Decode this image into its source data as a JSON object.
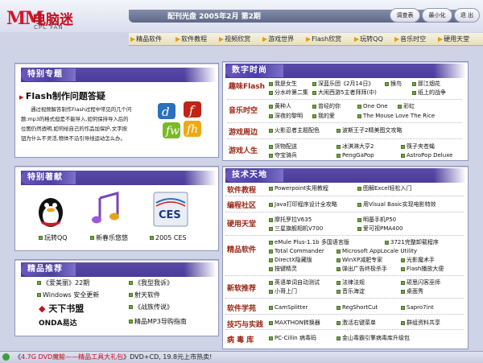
{
  "app": {
    "logo_mark": "MM",
    "logo_cn": "电脑迷",
    "logo_en": "CPC FAN",
    "issue": "配刊光盘   2005年2月 第2期"
  },
  "window_buttons": [
    {
      "label": "调查表"
    },
    {
      "label": "最小化"
    },
    {
      "label": "退 出"
    }
  ],
  "nav": [
    {
      "label": "精品软件"
    },
    {
      "label": "软件教程"
    },
    {
      "label": "视频欣赏"
    },
    {
      "label": "游戏世界"
    },
    {
      "label": "Flash欣赏"
    },
    {
      "label": "玩转QQ"
    },
    {
      "label": "音乐时空"
    },
    {
      "label": "硬用天堂"
    }
  ],
  "special_topic": {
    "title": "特别专题",
    "headline": "Flash制作问题答疑",
    "body_lines": [
      "通过视频解答制作Flash过程中常见的几个问",
      "题:mp3的格式但是不能导入,如何保持导入后的",
      "位图仍然透明,如何给自己的作品加保护,文字按",
      "钮为什么不灵活,物体不沿引导线运动怎么办。"
    ]
  },
  "special_gifts": {
    "title": "特别著献",
    "items": [
      {
        "label": "玩转QQ"
      },
      {
        "label": "新春乐悠悠"
      },
      {
        "label": "2005 CES"
      }
    ]
  },
  "recommend": {
    "title": "精品推荐",
    "items": [
      {
        "label": "《爱美丽》22期"
      },
      {
        "label": "《我型我诉》"
      },
      {
        "label": "Windows 安全更新"
      },
      {
        "label": "射天软件"
      },
      {
        "label": "天下书盟"
      },
      {
        "label": "《战族传说》"
      },
      {
        "label": "ONDA易达"
      },
      {
        "label": "精品MP3导购指南"
      }
    ]
  },
  "digital_time": {
    "title": "数字时尚",
    "categories": [
      {
        "name": "趣味Flash",
        "items": [
          "我是女生",
          "深蓝乐团《2月14日》",
          "猴鸟",
          "那江烟花",
          "分水岭第二集",
          "大闹西游5主者拜拜(中)",
          "纸上的战争"
        ]
      },
      {
        "name": "音乐时空",
        "items": [
          "黄种人",
          "曾经的你",
          "One One",
          "彩虹",
          "深夜的黎明",
          "我的爱",
          "The Mouse Love The Rice"
        ]
      },
      {
        "name": "游戏周边",
        "items": [
          "火影忍者主题配色",
          "波斯王子2精美图文攻略"
        ]
      },
      {
        "name": "游戏人生",
        "items": [
          "货物配送",
          "冰淇淋大亨2",
          "筷子夹苍蝇",
          "夺宝骑兵",
          "PengGaPop",
          "AstroPop Deluxe"
        ]
      }
    ]
  },
  "tech": {
    "title": "技术天地",
    "categories": [
      {
        "name": "软件教程",
        "items": [
          "Powerpoint实用教程",
          "图解Excel轻松入门"
        ]
      },
      {
        "name": "编程社区",
        "items": [
          "Java打印程序设计全攻略",
          "用Visual Basic实现电影特效"
        ]
      },
      {
        "name": "硬用天堂",
        "items": [
          "摩托罗拉V635",
          "明基手机P50",
          "三星旗舰相机V700",
          "爱可视PMA400"
        ]
      },
      {
        "name": "精品软件",
        "items": [
          "eMule Plus-1.1b 多国语言版",
          "3721完整卸载程序",
          "Total Commander",
          "Microsoft AppLocale Utility",
          "DirectX隐藏版",
          "WinXP减肥专家",
          "光影魔术手",
          "按键精灵",
          "弹出广告终极杀手",
          "Flash播放大便"
        ]
      },
      {
        "name": "新软推荐",
        "items": [
          "英语单词自动测试",
          "法律法规",
          "硕思闪客巫师",
          "小哥上门",
          "音乐海淀",
          "桌面秀"
        ]
      },
      {
        "name": "软件学苑",
        "items": [
          "CamSplitter",
          "RegShortCut",
          "Sapro7int"
        ]
      },
      {
        "name": "技巧与实践",
        "items": [
          "MAXTHON转换器",
          "激活右键菜单",
          "群组资料共享"
        ]
      },
      {
        "name": "病 毒 库",
        "items": [
          "PC-Cillin 病毒码",
          "金山毒霸引擎病毒库升级包"
        ]
      }
    ]
  },
  "status": {
    "prefix": "《",
    "highlight": "4.7G DVD魔鲸——精品工具大礼包",
    "suffix": "》DVD+CD, 19.8元上市热卖!"
  },
  "colors": {
    "accent": "#4b3fa3",
    "category": "#9a2412",
    "bullet": "#6aa83a"
  }
}
